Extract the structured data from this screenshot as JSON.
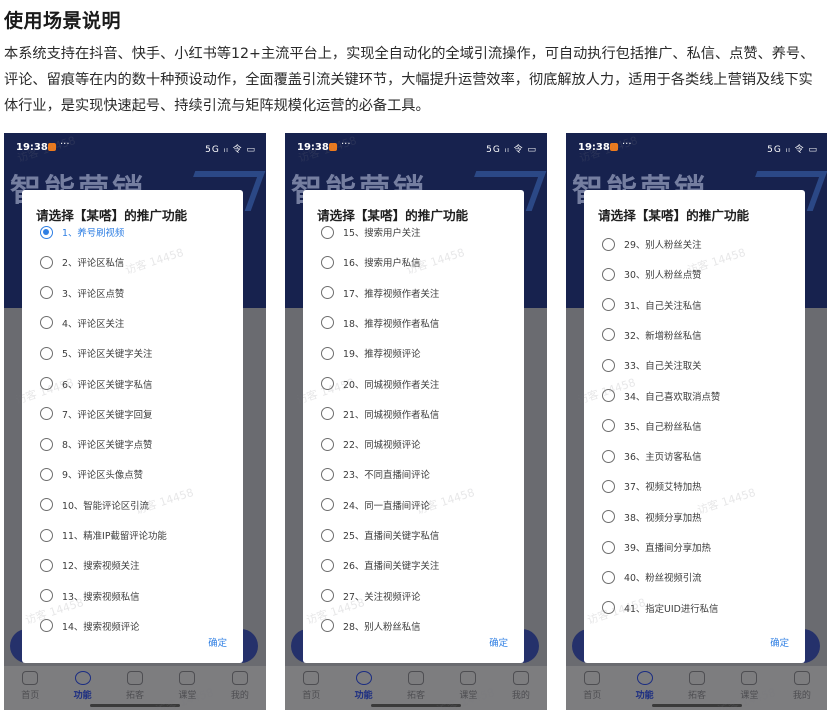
{
  "article": {
    "heading": "使用场景说明",
    "description": "本系统支持在抖音、快手、小红书等12+主流平台上，实现全自动化的全域引流操作，可自动执行包括推广、私信、点赞、养号、评论、留痕等在内的数十种预设动作，全面覆盖引流关键环节，大幅提升运营效率，彻底解放人力，适用于各类线上营销及线下实体行业，是实现快速起号、持续引流与矩阵规模化运营的必备工具。"
  },
  "phones": [
    {
      "statusbar": {
        "time": "19:38",
        "more": "···",
        "signal": "5G ᵢₗ 令 ▭"
      },
      "banner_text": "智能营销",
      "dialog": {
        "title": "请选择【某嗒】的推广功能",
        "confirm_label": "确定",
        "options": [
          {
            "label": "1、养号刷视频",
            "checked": true
          },
          {
            "label": "2、评论区私信",
            "checked": false
          },
          {
            "label": "3、评论区点赞",
            "checked": false
          },
          {
            "label": "4、评论区关注",
            "checked": false
          },
          {
            "label": "5、评论区关键字关注",
            "checked": false
          },
          {
            "label": "6、评论区关键字私信",
            "checked": false
          },
          {
            "label": "7、评论区关键字回复",
            "checked": false
          },
          {
            "label": "8、评论区关键字点赞",
            "checked": false
          },
          {
            "label": "9、评论区头像点赞",
            "checked": false
          },
          {
            "label": "10、智能评论区引流",
            "checked": false
          },
          {
            "label": "11、精准IP截留评论功能",
            "checked": false
          },
          {
            "label": "12、搜索视频关注",
            "checked": false
          },
          {
            "label": "13、搜索视频私信",
            "checked": false
          },
          {
            "label": "14、搜索视频评论",
            "checked": false
          }
        ]
      },
      "tabs": [
        {
          "label": "首页",
          "icon": "home-icon",
          "active": false
        },
        {
          "label": "功能",
          "icon": "function-icon",
          "active": true
        },
        {
          "label": "拓客",
          "icon": "customer-icon",
          "active": false
        },
        {
          "label": "课堂",
          "icon": "classroom-icon",
          "active": false
        },
        {
          "label": "我的",
          "icon": "heart-icon",
          "active": false
        }
      ]
    },
    {
      "statusbar": {
        "time": "19:38",
        "more": "···",
        "signal": "5G ᵢₗ 令 ▭"
      },
      "banner_text": "智能营销",
      "dialog": {
        "title": "请选择【某嗒】的推广功能",
        "confirm_label": "确定",
        "options": [
          {
            "label": "15、搜索用户关注",
            "checked": false
          },
          {
            "label": "16、搜索用户私信",
            "checked": false
          },
          {
            "label": "17、推荐视频作者关注",
            "checked": false
          },
          {
            "label": "18、推荐视频作者私信",
            "checked": false
          },
          {
            "label": "19、推荐视频评论",
            "checked": false
          },
          {
            "label": "20、同城视频作者关注",
            "checked": false
          },
          {
            "label": "21、同城视频作者私信",
            "checked": false
          },
          {
            "label": "22、同城视频评论",
            "checked": false
          },
          {
            "label": "23、不同直播间评论",
            "checked": false
          },
          {
            "label": "24、同一直播间评论",
            "checked": false
          },
          {
            "label": "25、直播间关键字私信",
            "checked": false
          },
          {
            "label": "26、直播间关键字关注",
            "checked": false
          },
          {
            "label": "27、关注视频评论",
            "checked": false
          },
          {
            "label": "28、别人粉丝私信",
            "checked": false
          }
        ]
      },
      "tabs": [
        {
          "label": "首页",
          "icon": "home-icon",
          "active": false
        },
        {
          "label": "功能",
          "icon": "function-icon",
          "active": true
        },
        {
          "label": "拓客",
          "icon": "customer-icon",
          "active": false
        },
        {
          "label": "课堂",
          "icon": "classroom-icon",
          "active": false
        },
        {
          "label": "我的",
          "icon": "heart-icon",
          "active": false
        }
      ]
    },
    {
      "statusbar": {
        "time": "19:38",
        "more": "···",
        "signal": "5G ᵢₗ 令 ▭"
      },
      "banner_text": "智能营销",
      "dialog": {
        "title": "请选择【某嗒】的推广功能",
        "confirm_label": "确定",
        "options": [
          {
            "label": "29、别人粉丝关注",
            "checked": false
          },
          {
            "label": "30、别人粉丝点赞",
            "checked": false
          },
          {
            "label": "31、自己关注私信",
            "checked": false
          },
          {
            "label": "32、新增粉丝私信",
            "checked": false
          },
          {
            "label": "33、自己关注取关",
            "checked": false
          },
          {
            "label": "34、自己喜欢取消点赞",
            "checked": false
          },
          {
            "label": "35、自己粉丝私信",
            "checked": false
          },
          {
            "label": "36、主页访客私信",
            "checked": false
          },
          {
            "label": "37、视频艾特加热",
            "checked": false
          },
          {
            "label": "38、视频分享加热",
            "checked": false
          },
          {
            "label": "39、直播间分享加热",
            "checked": false
          },
          {
            "label": "40、粉丝视频引流",
            "checked": false
          },
          {
            "label": "41、指定UID进行私信",
            "checked": false
          }
        ]
      },
      "tabs": [
        {
          "label": "首页",
          "icon": "home-icon",
          "active": false
        },
        {
          "label": "功能",
          "icon": "function-icon",
          "active": true
        },
        {
          "label": "拓客",
          "icon": "customer-icon",
          "active": false
        },
        {
          "label": "课堂",
          "icon": "classroom-icon",
          "active": false
        },
        {
          "label": "我的",
          "icon": "heart-icon",
          "active": false
        }
      ]
    }
  ],
  "watermark": "访客 14458"
}
